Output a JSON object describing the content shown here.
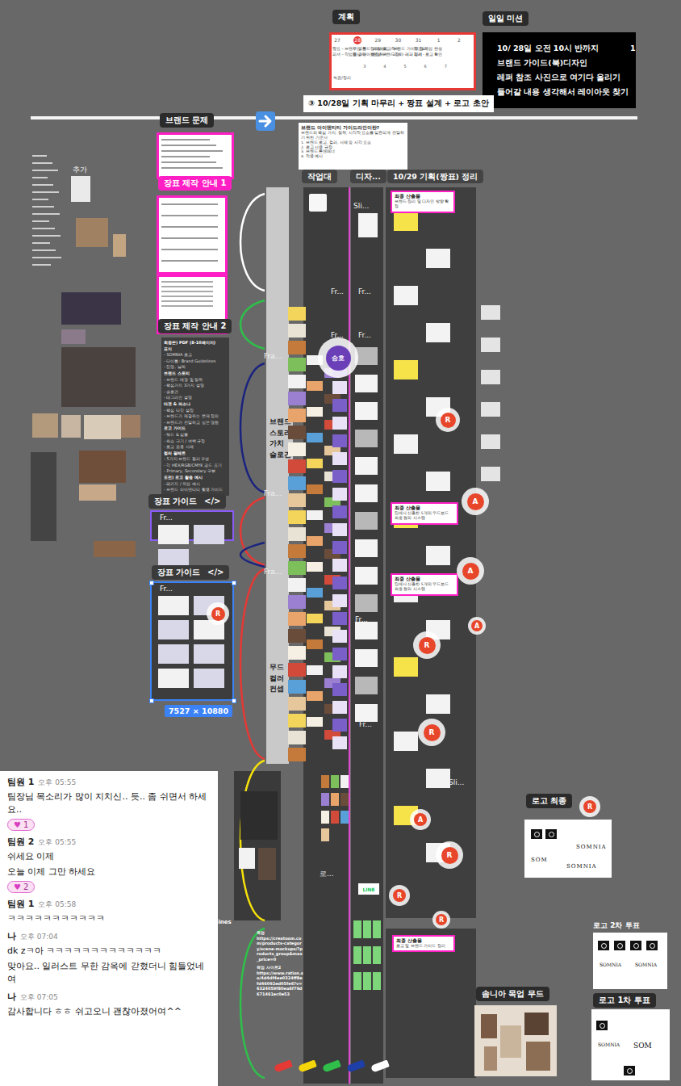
{
  "plan": {
    "label": "계획",
    "days": [
      {
        "day": "27",
        "selected": false
      },
      {
        "day": "28",
        "selected": true
      },
      {
        "day": "29",
        "selected": false
      },
      {
        "day": "30",
        "selected": false
      },
      {
        "day": "31",
        "selected": false
      },
      {
        "day": "1",
        "selected": false
      },
      {
        "day": "2",
        "selected": false
      }
    ],
    "entries": [
      "짱표 – 브랜드 공부",
      "피셔 – 작업물 공유",
      "무민 톱드링크/레퍼",
      "협상-타이틀 정하기",
      "매칭 로고/작식",
      "협상-브랜드 정리",
      "브랜드 가이드 정리",
      "피셔 - 레퍼 정리",
      "짱표&목업 완성",
      "피셔 - 로고 확인"
    ],
    "week2": [
      "3",
      "4",
      "5",
      "6",
      "7"
    ],
    "note": "녹음/정리"
  },
  "mission": {
    "label": "일일 미션",
    "lines": [
      "10/ 28일 오전 10시 반까지",
      "브랜드 가이드(북)디자인",
      "레퍼 참조 사진으로 여기다 올리기",
      "들어갈 내용 생각해서 레이아웃 찾기"
    ],
    "overflow": "1"
  },
  "brand_problem": "브랜드 문제",
  "stage_title": "③ 10/28일 기획 마무리 + 짱표 설계 + 로고 초안",
  "doc": {
    "title": "브랜드 아이덴티티 가이드라인이란?",
    "lines": [
      "브랜드의 핵심 가치, 철학, 시각적 요소를 일관되게 전달하기 위한 기준서",
      "1. 브랜드 로고, 컬러, 서체 등 시각 요소",
      "2. 로고 사용 규정",
      "3. 브랜드 톤앤매너",
      "4. 적용 예시"
    ]
  },
  "columns": [
    "작업대",
    "디자...",
    "10/29 기획(짱표) 정리"
  ],
  "guide_docs": [
    "장표 제작 안내 1",
    "장표 제작 안내 2"
  ],
  "extra_label": "추가",
  "outline": [
    "최종본) PDF (8-10페이지)",
    "표지",
    "- SOMNIA 로고",
    "- 타이틀: Brand Guidelines",
    "- 팀명, 날짜",
    "브랜드 스토리",
    "- 브랜드 배경 및 철학",
    "- 핵심가치 3가지 설명",
    "- 슬로건",
    "- 태그라인 설명",
    "타겟 & 퍼소나",
    "- 핵심 타깃 설정",
    "- 브랜드가 해결하는 문제 정의",
    "- 브랜드가 전달하고 싶은 경험",
    "로고 가이드",
    "- 워드 & 심볼",
    "- 최소 크기 / 여백 규정",
    "- 로고 오용 사례",
    "컬러 팔레트",
    "- 5가지 브랜드 컬러 구성",
    "- 각 HEX/RGB/CMYK 코드 표기",
    "- Primary, Secondary 구분",
    "도전) 로고 활용 예시",
    "- 패키지 / 목업 예시",
    "- 브랜드 아이덴티티 활용 가이드"
  ],
  "guide_frames": [
    {
      "label": "장표 가이드",
      "code": "</>",
      "frame_label": "Fr...",
      "selected": false
    },
    {
      "label": "장표 가이드",
      "code": "</>",
      "frame_label": "Fr...",
      "selected": true,
      "size": "7527 × 10880"
    }
  ],
  "sections": [
    {
      "lines": [
        "브랜드",
        "스토리",
        "가치",
        "슬로건"
      ]
    },
    {
      "lines": [
        "무드",
        "컬러",
        "컨셉"
      ]
    }
  ],
  "frame_labels": [
    "Fra...",
    "Fra...",
    "Fra...",
    "Fr...",
    "Fr...",
    "Fr...",
    "Fr...",
    "Fr...",
    "Sli...",
    "Sli...",
    "로...",
    "Fr..."
  ],
  "line_label": "LINE",
  "avatars": [
    {
      "initial": "승호",
      "color": "#6b3fb8"
    },
    {
      "initial": "R",
      "color": "#e8462b"
    },
    {
      "initial": "A",
      "color": "#e8462b"
    },
    {
      "initial": "A",
      "color": "#e8462b"
    },
    {
      "initial": "R",
      "color": "#e8462b"
    },
    {
      "initial": "A",
      "color": "#e8462b"
    },
    {
      "initial": "R",
      "color": "#e8462b"
    },
    {
      "initial": "R",
      "color": "#e8462b"
    },
    {
      "initial": "R",
      "color": "#e8462b"
    },
    {
      "initial": "A",
      "color": "#e8462b"
    },
    {
      "initial": "R",
      "color": "#e8462b"
    },
    {
      "initial": "R",
      "color": "#e8462b"
    },
    {
      "initial": "R",
      "color": "#e8462b"
    }
  ],
  "cards": [
    {
      "title": "최종 산출물",
      "lines": [
        "브랜드 정리 및 디자인 방향 확정"
      ]
    },
    {
      "title": "최종 산출물",
      "lines": [
        "팀에서 산출한 5개의 무드보드",
        "최종 협의 시스템"
      ]
    },
    {
      "title": "최종 산출물",
      "lines": [
        "팀에서 산출한 5개의 무드보드",
        "최종 협의 시스템"
      ]
    },
    {
      "title": "최종 산출물",
      "lines": [
        "로고 및 브랜드 가이드 정리"
      ]
    }
  ],
  "links": {
    "title": "목업",
    "url": "https://creatoom.com/products-category/scene-mockups/?products_group&max_price=0",
    "title2": "목업 사이트2",
    "url2": "https://www.ration.so/4d4df4ee0324ff8efd46092ed05fe6?v=6324059f80ea6f79d671461ec0e53"
  },
  "guidelines_label": "lines",
  "logo": {
    "final_label": "로고 최종",
    "final_words": [
      "SOMNIA",
      "SOM",
      "SOMNIA"
    ],
    "vote2_label": "로고 2차 투표",
    "vote2_words": [
      "SOMNIA",
      "SOMNIA"
    ],
    "vote1_label": "로고 1차 투표",
    "vote1_words": [
      "SOMNIA",
      "SOM"
    ],
    "mood_label": "솜니아 목업 무드"
  },
  "brackets": [
    {
      "color": "#ffffff"
    },
    {
      "color": "#2fbf4a"
    },
    {
      "color": "#1a237e"
    },
    {
      "color": "#e53935"
    },
    {
      "color": "#1a237e"
    },
    {
      "color": "#e53935"
    },
    {
      "color": "#f5e10a"
    },
    {
      "color": "#2fbf4a"
    }
  ],
  "pens": [
    {
      "color": "#e53935"
    },
    {
      "color": "#f5d60a"
    },
    {
      "color": "#2fbf4a"
    },
    {
      "color": "#1e3ea8"
    },
    {
      "color": "#ffffff"
    }
  ],
  "chat": [
    {
      "name": "팀원 1",
      "time": "오후 05:55",
      "lines": [
        "팀장님 목소리가 많이 지치신.. 듯.. 좀 쉬면서 하세요.."
      ],
      "reaction": {
        "icon": "♥",
        "count": "1"
      }
    },
    {
      "name": "팀원 2",
      "time": "오후 05:55",
      "lines": [
        "쉬세요 이제",
        "오늘 이제 그만 하세요"
      ],
      "reaction": {
        "icon": "♥",
        "count": "2"
      }
    },
    {
      "name": "팀원 1",
      "time": "오후 05:58",
      "lines": [
        "ㅋㅋㅋㅋㅋㅋㅋㅋㅋㅋㅋ"
      ]
    },
    {
      "name": "나",
      "time": "오후 07:04",
      "lines": [
        "dk zㅋ아 ㅋㅋㅋㅋㅋㅋㅋㅋㅋㅋㅋㅋㅋ",
        "맞아요.. 일러스트 무한 감옥에 갇혔더니 힘들었네여"
      ]
    },
    {
      "name": "나",
      "time": "오후 07:05",
      "lines": [
        "감사합니다 ㅎㅎ 쉬고오니 괜찮아졌어여^^"
      ]
    }
  ]
}
